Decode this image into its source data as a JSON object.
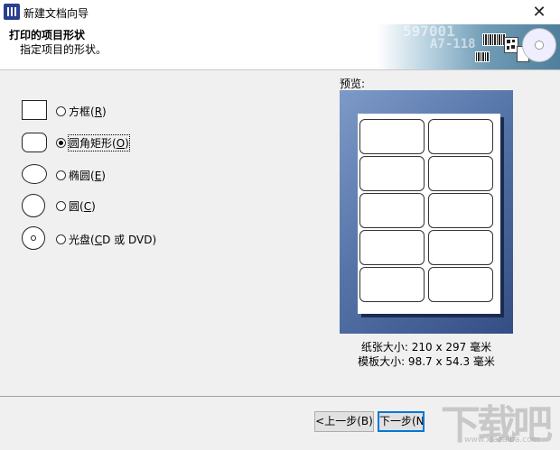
{
  "window": {
    "title": "新建文档向导",
    "close_symbol": "✕"
  },
  "header": {
    "title": "打印的项目形状",
    "subtitle": "指定项目的形状。",
    "banner_text_1": "597001",
    "banner_text_2": "A7-118"
  },
  "shapes": {
    "options": [
      {
        "label": "方框",
        "hotkey": "R",
        "checked": false
      },
      {
        "label": "圆角矩形",
        "hotkey": "O",
        "checked": true
      },
      {
        "label": "椭圆",
        "hotkey": "E",
        "checked": false
      },
      {
        "label": "圆",
        "hotkey": "C",
        "checked": false
      },
      {
        "label": "光盘",
        "hotkey": "C",
        "suffix": "D 或 DVD",
        "checked": false
      }
    ]
  },
  "preview": {
    "label": "预览:",
    "paper_size": "纸张大小: 210 x 297 毫米",
    "template_size": "模板大小: 98.7 x 54.3 毫米",
    "rows": 5,
    "cols": 2
  },
  "buttons": {
    "back": "<上一步(B)",
    "next": "下一步(N"
  },
  "watermark": {
    "text": "下载吧",
    "url": "www.xiazaiba.com"
  },
  "colors": {
    "preview_bg": "#5574a8",
    "primary_border": "#0078d7"
  }
}
